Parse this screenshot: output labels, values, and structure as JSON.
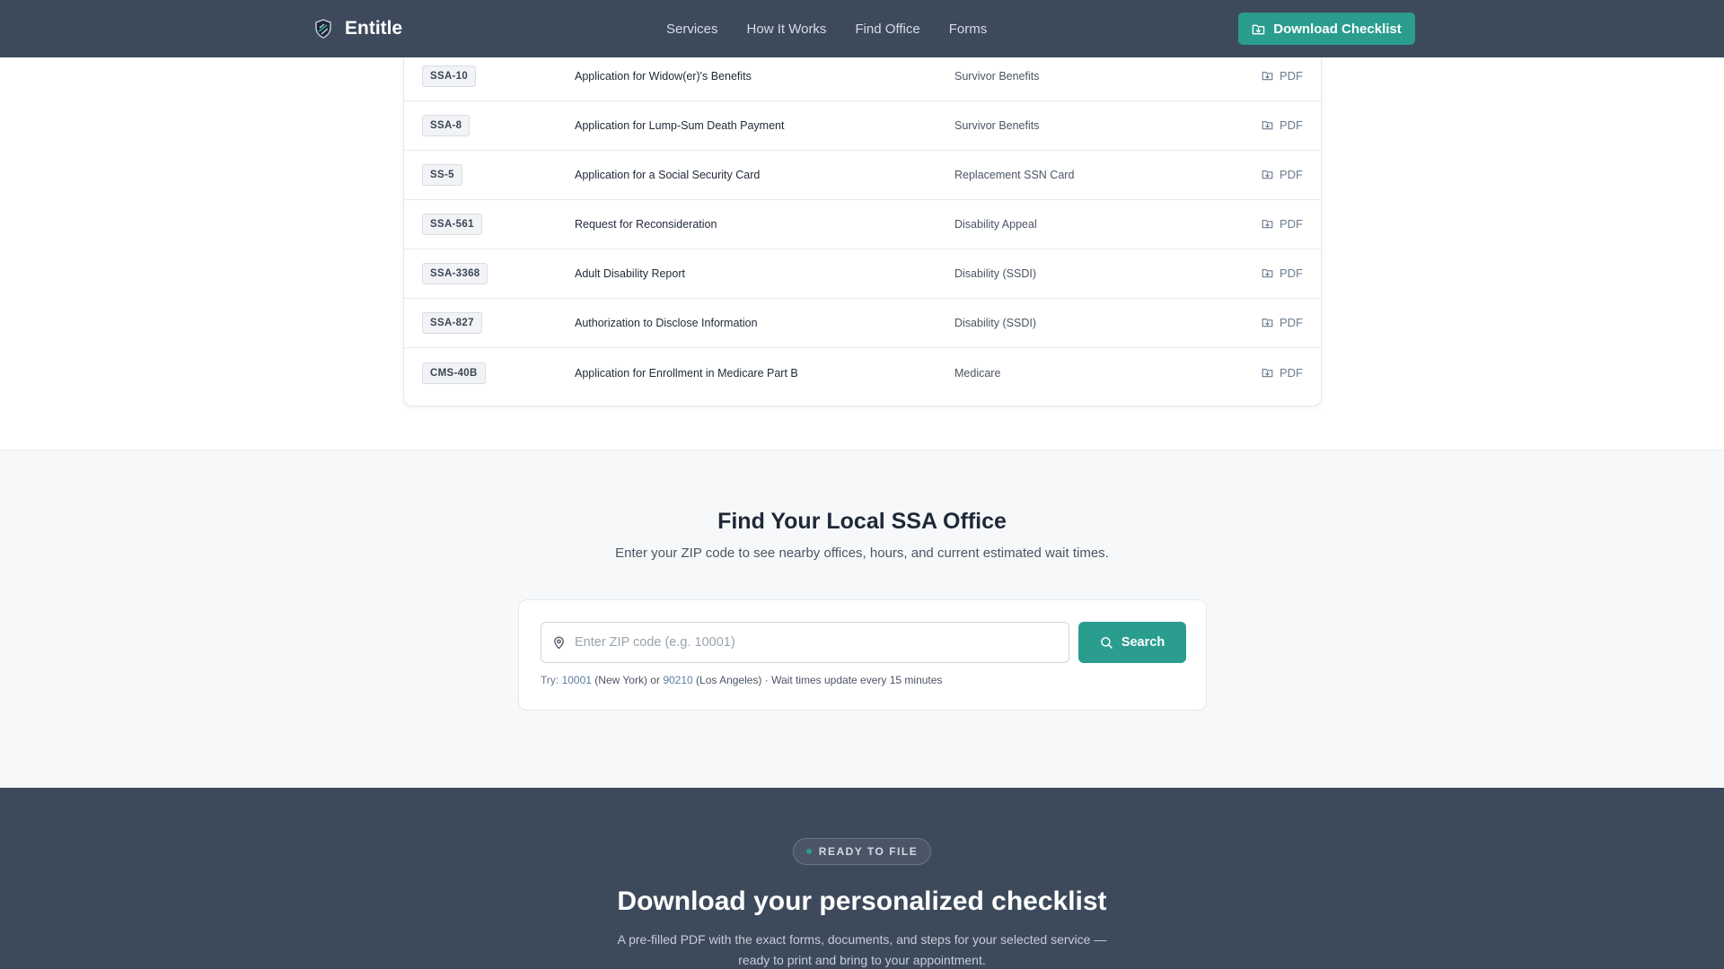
{
  "header": {
    "brand": "Entitle",
    "nav": [
      "Services",
      "How It Works",
      "Find Office",
      "Forms"
    ],
    "cta_label": "Download Checklist"
  },
  "forms": {
    "rows": [
      {
        "code": "SSA-10",
        "title": "Application for Widow(er)'s Benefits",
        "category": "Survivor Benefits",
        "link": "PDF"
      },
      {
        "code": "SSA-8",
        "title": "Application for Lump-Sum Death Payment",
        "category": "Survivor Benefits",
        "link": "PDF"
      },
      {
        "code": "SS-5",
        "title": "Application for a Social Security Card",
        "category": "Replacement SSN Card",
        "link": "PDF"
      },
      {
        "code": "SSA-561",
        "title": "Request for Reconsideration",
        "category": "Disability Appeal",
        "link": "PDF"
      },
      {
        "code": "SSA-3368",
        "title": "Adult Disability Report",
        "category": "Disability (SSDI)",
        "link": "PDF"
      },
      {
        "code": "SSA-827",
        "title": "Authorization to Disclose Information",
        "category": "Disability (SSDI)",
        "link": "PDF"
      },
      {
        "code": "CMS-40B",
        "title": "Application for Enrollment in Medicare Part B",
        "category": "Medicare",
        "link": "PDF"
      }
    ]
  },
  "office": {
    "title": "Find Your Local SSA Office",
    "subtitle": "Enter your ZIP code to see nearby offices, hours, and current estimated wait times.",
    "zip_value": "",
    "zip_placeholder": "Enter ZIP code (e.g. 10001)",
    "search_label": "Search",
    "hint": {
      "try": "Try:",
      "zip1": "10001",
      "city1": "(New York) or",
      "zip2": "90210",
      "city2": "(Los Angeles)",
      "note": "· Wait times update every 15 minutes"
    }
  },
  "checklist": {
    "pill": "READY TO FILE",
    "title": "Download your personalized checklist",
    "description": "A pre-filled PDF with the exact forms, documents, and steps for your selected service — ready to print and bring to your appointment."
  },
  "colors": {
    "header_bg": "#3d4a5c",
    "accent": "#2a9d8f",
    "section_bg": "#f7f8fa"
  },
  "icons": {
    "brand": "shield-logo-icon",
    "cta": "download-icon",
    "pdf": "download-icon",
    "zip": "map-pin-icon",
    "search": "search-icon"
  }
}
